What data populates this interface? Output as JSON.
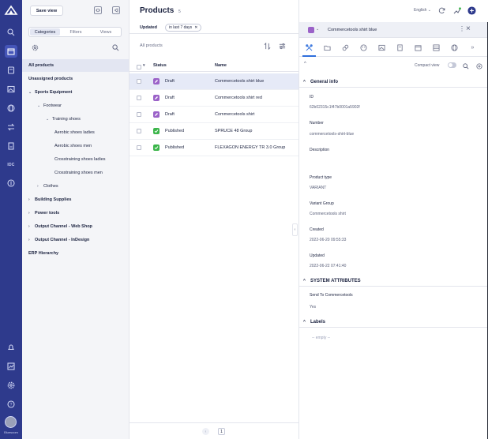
{
  "rail": {
    "user_label": "Bluesoom"
  },
  "sidebar": {
    "save_view": "Save view",
    "tabs": [
      "Categories",
      "Filters",
      "Views"
    ],
    "tree": [
      {
        "label": "All products",
        "level": 0,
        "bold": true,
        "selected": true,
        "caret": ""
      },
      {
        "label": "Unassigned products",
        "level": 0,
        "bold": true,
        "caret": ""
      },
      {
        "label": "Sports Equipment",
        "level": 0,
        "bold": true,
        "caret": "v"
      },
      {
        "label": "Footwear",
        "level": 1,
        "caret": "v"
      },
      {
        "label": "Training shoes",
        "level": 2,
        "caret": "v"
      },
      {
        "label": "Aerobic shoes ladies",
        "level": 3,
        "caret": ""
      },
      {
        "label": "Aerobic shoes men",
        "level": 3,
        "caret": ""
      },
      {
        "label": "Crosstraining shoes ladies",
        "level": 3,
        "caret": ""
      },
      {
        "label": "Crosstraining shoes men",
        "level": 3,
        "caret": ""
      },
      {
        "label": "Clothes",
        "level": 1,
        "caret": ">"
      },
      {
        "label": "Building Supplies",
        "level": 0,
        "bold": true,
        "caret": ">"
      },
      {
        "label": "Power tools",
        "level": 0,
        "bold": true,
        "caret": ">"
      },
      {
        "label": "Output Channel - Web Shop",
        "level": 0,
        "bold": true,
        "caret": ">"
      },
      {
        "label": "Output Channel - InDesign",
        "level": 0,
        "bold": true,
        "caret": ">"
      },
      {
        "label": "ERP Hierarchy",
        "level": 0,
        "bold": true,
        "caret": ""
      }
    ]
  },
  "list": {
    "title": "Products",
    "count": "5",
    "filter_key": "Updated",
    "filter_value": "in last 7 days",
    "scope": "All products",
    "columns": {
      "status": "Status",
      "name": "Name"
    },
    "rows": [
      {
        "status": "Draft",
        "name": "Commercetools shirt blue",
        "selected": true
      },
      {
        "status": "Draft",
        "name": "Commercetools shirt red"
      },
      {
        "status": "Draft",
        "name": "Commercetools shirt"
      },
      {
        "status": "Published",
        "name": "SPRUCE 48 Group"
      },
      {
        "status": "Published",
        "name": "FLEXAGON ENERGY TR 3.0 Group"
      }
    ],
    "page": "1"
  },
  "topbar": {
    "language": "English"
  },
  "detail": {
    "title": "Commercetools shirt blue",
    "compact_view": "Compact view",
    "sections": {
      "general": "General info",
      "system": "SYSTEM ATTRIBUTES",
      "labels": "Labels"
    },
    "fields": {
      "id_label": "ID",
      "id_value": "62b02315c1f47b0001a5902f",
      "number_label": "Number",
      "number_value": "commercetools-shirt-blue",
      "description_label": "Description",
      "product_type_label": "Product type",
      "product_type_value": "VARIANT",
      "variant_group_label": "Variant Group",
      "variant_group_value": "Commercetools shirt",
      "created_label": "Created",
      "created_value": "2022-06-20 09:55:33",
      "updated_label": "Updated",
      "updated_value": "2022-06-22 07:41:40",
      "send_label": "Send To Commercetools",
      "send_value": "Yes"
    },
    "labels_empty": "-- empty --"
  },
  "colors": {
    "rail": "#2e3a8c",
    "draft": "#9b62c8",
    "published": "#3bb54a",
    "accent": "#2f6fdc"
  }
}
